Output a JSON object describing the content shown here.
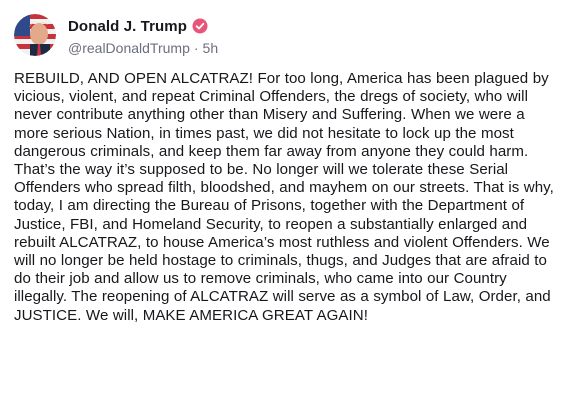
{
  "author": {
    "display_name": "Donald J. Trump",
    "handle": "@realDonaldTrump",
    "separator": "·",
    "timestamp": "5h",
    "verified_icon": "verified-badge-icon"
  },
  "post": {
    "text": "REBUILD, AND OPEN ALCATRAZ! For too long, America has been plagued by vicious, violent, and repeat Criminal Offenders, the dregs of society, who will never contribute anything other than Misery and Suffering. When we were a more serious Nation, in times past, we did not hesitate to lock up the most dangerous criminals, and keep them far away from anyone they could harm. That’s the way it’s supposed to be. No longer will we tolerate these Serial Offenders who spread filth, bloodshed, and mayhem on our streets. That is why, today, I am directing the Bureau of Prisons, together with the Department of Justice, FBI, and Homeland Security, to reopen a substantially enlarged and rebuilt ALCATRAZ, to house America’s most ruthless and violent Offenders. We will no longer be held hostage to criminals, thugs, and Judges that are afraid to do their job and allow us to remove criminals, who came into our Country illegally. The reopening of ALCATRAZ will serve as a symbol of Law, Order, and JUSTICE. We will, MAKE AMERICA GREAT AGAIN!"
  },
  "colors": {
    "verified_badge": "#e8547a",
    "meta_text": "#6b6f7e",
    "body_text": "#17181c"
  }
}
